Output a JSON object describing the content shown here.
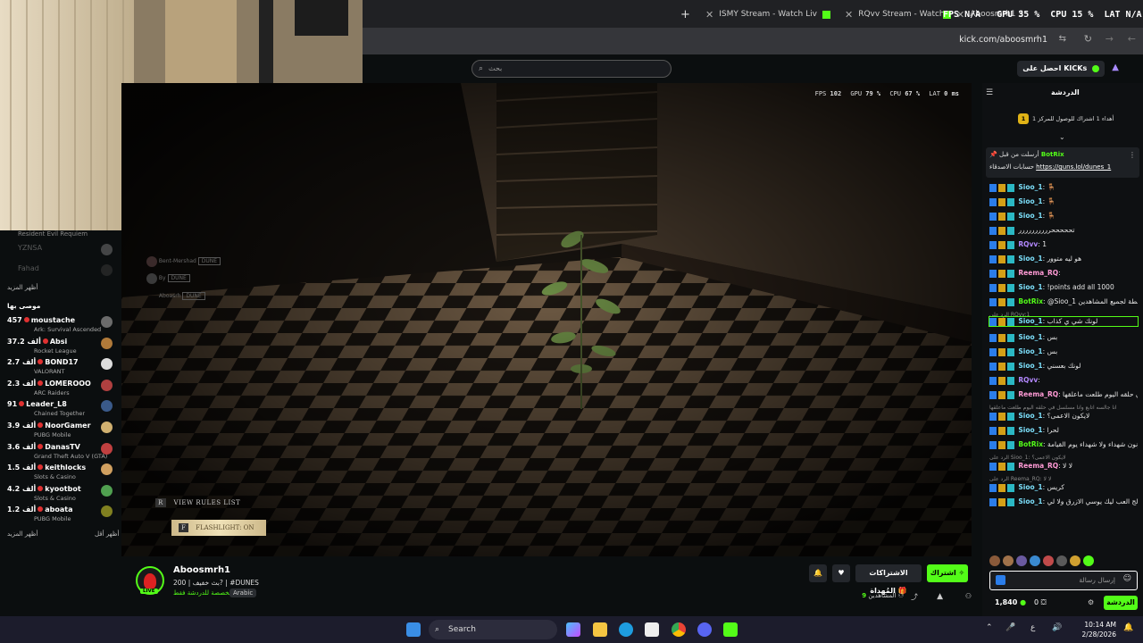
{
  "browser": {
    "new_tab_icon": "plus-icon",
    "tabs": [
      {
        "title": "ISMY Stream - Watch Live on Kick"
      },
      {
        "title": "RQvv Stream - Watch Live on Kick"
      },
      {
        "title": "Aboosmrh1 Stream - Watch Live on Kick"
      }
    ],
    "url": "kick.com/aboosmrh1",
    "perf_overlay": {
      "fps_label": "FPS",
      "fps": "N/A",
      "gpu_label": "GPU",
      "gpu": "35 %",
      "cpu_label": "CPU",
      "cpu": "15 %",
      "lat_label": "LAT",
      "lat": "N/A"
    }
  },
  "kick": {
    "search_placeholder": "بحث",
    "get_kicks": "احصل على KICKs"
  },
  "sidebar": {
    "top_items": [
      {
        "name": "Resident Evil Requiem"
      },
      {
        "name": "YZNSA"
      },
      {
        "name": "Fahad"
      }
    ],
    "show_more_1": "أظهر المزيد",
    "recommended_title": "موصى بها",
    "channels": [
      {
        "name": "moustache",
        "viewers": "457",
        "category": "Ark: Survival Ascended"
      },
      {
        "name": "Absi",
        "viewers": "37.2 ألف",
        "category": "Rocket League"
      },
      {
        "name": "BOND17",
        "viewers": "2.7 ألف",
        "category": "VALORANT"
      },
      {
        "name": "LOMEROOO",
        "viewers": "2.3 ألف",
        "category": "ARC Raiders"
      },
      {
        "name": "Leader_L8",
        "viewers": "91",
        "category": "Chained Together"
      },
      {
        "name": "NoorGamer",
        "viewers": "3.9 ألف",
        "category": "PUBG Mobile"
      },
      {
        "name": "DanasTV",
        "viewers": "3.6 ألف",
        "category": "Grand Theft Auto V (GTA)"
      },
      {
        "name": "keithlocks",
        "viewers": "1.5 ألف",
        "category": "Slots & Casino"
      },
      {
        "name": "kyootbot",
        "viewers": "4.2 ألف",
        "category": "Slots & Casino"
      },
      {
        "name": "aboata",
        "viewers": "1.2 ألف",
        "category": "PUBG Mobile"
      }
    ],
    "show_more_2": "أظهر المزيد",
    "show_less": "أظهر أقل"
  },
  "video": {
    "hud": {
      "fps": "102",
      "gpu": "79 %",
      "cpu": "67 %",
      "lat": "0 ms"
    },
    "overlay_names": [
      "Bent-Mershad",
      "By",
      "Aboasrh"
    ],
    "overlay_tag": "DUNE",
    "view_rules_key": "R",
    "view_rules": "VIEW RULES LIST",
    "flashlight_key": "F",
    "flashlight": "FLASHLIGHT: ON"
  },
  "stream": {
    "channel": "Aboosmrh1",
    "title": "بث خفيف | 200? | #DUNES",
    "live_badge": "LIVE",
    "category": "مخصصة للدردشة فقط",
    "language": "Arabic",
    "viewers_label": "المشاهدين",
    "viewers": "9",
    "subscribe": "اشتراك",
    "gift_subs": "الاشتراكات المُهداة"
  },
  "chat": {
    "title": "الدردشة",
    "top_gifter": "1",
    "top_gifter_text": "أهداء 1 اشتراك للوصول للمركز 1",
    "pinned_user": "BotRix",
    "pinned_prefix": "أرسلت من قبل",
    "pinned_text": "حسابات الاصدقاء",
    "pinned_link": "https://guns.lol/dunes_1",
    "messages": [
      {
        "user": "Sioo_1",
        "text": "🪑",
        "color": "#7cdffb"
      },
      {
        "user": "Sioo_1",
        "text": "🪑",
        "color": "#7cdffb"
      },
      {
        "user": "Sioo_1",
        "text": "🪑",
        "color": "#7cdffb"
      },
      {
        "user": "",
        "text": "تحححححرررررررررر",
        "color": "#7cdffb"
      },
      {
        "user": "RQvv",
        "text": "1",
        "color": "#b388ff"
      },
      {
        "user": "Sioo_1",
        "text": "هو ليه متوور",
        "color": "#7cdffb"
      },
      {
        "user": "Reema_RQ",
        "text": "",
        "color": "#ff9ad5"
      },
      {
        "user": "Sioo_1",
        "text": "!points add all 1000",
        "color": "#7cdffb"
      },
      {
        "user": "BotRix",
        "text": "@Sioo_1 تمت إضافة 1000 نقطة لجميع المشاهدين",
        "color": "#53fc18"
      },
      {
        "user": "Sioo_1",
        "text": "لونك شي ي كذاب",
        "color": "#7cdffb",
        "reply": "الرد على RQvv:1"
      },
      {
        "user": "Sioo_1",
        "text": "بس",
        "color": "#7cdffb"
      },
      {
        "user": "Sioo_1",
        "text": "بس",
        "color": "#7cdffb"
      },
      {
        "user": "Sioo_1",
        "text": "لونك بعسني",
        "color": "#7cdffb"
      },
      {
        "user": "RQvv",
        "text": "",
        "color": "#b388ff"
      },
      {
        "user": "Reema_RQ",
        "text": "انا جالسه اتابع وانا مسلسل في حلقه اليوم طلعت ماعلقها",
        "color": "#ff9ad5"
      },
      {
        "user": "Sioo_1",
        "text": "لايكون الاعمى؟",
        "color": "#7cdffb",
        "reply": "انا جالسه اتابع وانا مسلسل في حلقه اليوم طلعت ماعلقها"
      },
      {
        "user": "Sioo_1",
        "text": "لحرا",
        "color": "#7cdffb"
      },
      {
        "user": "BotRix",
        "text": "إن اللاعبين لا يكونون شهداء ولا شهداء يوم القيامة",
        "color": "#53fc18"
      },
      {
        "user": "Reema_RQ",
        "text": "لا لا",
        "color": "#ff9ad5",
        "reply": "الرد على Sioo_1: لايكون الاعمى؟"
      },
      {
        "user": "Sioo_1",
        "text": "كريس",
        "color": "#7cdffb",
        "reply": "الرد على Reema_RQ: لا لا"
      },
      {
        "user": "Sioo_1",
        "text": "ابو سعره تعالج العب ليك يوسي الازرق ولا لي",
        "color": "#7cdffb"
      }
    ],
    "input_placeholder": "إرسال رسالة",
    "points": "1,840",
    "gifts_count": "0",
    "send_label": "الدردشة"
  },
  "taskbar": {
    "search": "Search",
    "lang": "ع",
    "time": "10:14 AM",
    "date": "2/28/2026"
  }
}
